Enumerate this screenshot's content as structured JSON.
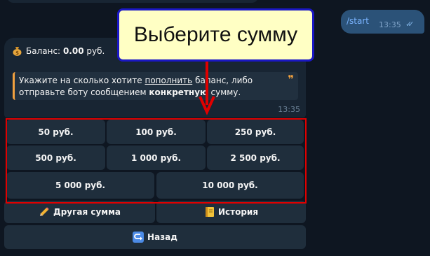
{
  "chat": {
    "outgoing": {
      "text": "/start",
      "time": "13:35"
    },
    "incoming": {
      "balance_prefix": "Баланс:",
      "balance_value": "0.00",
      "balance_currency": "руб.",
      "hint": {
        "part1": "Укажите на сколько хотите ",
        "link": "пополнить",
        "part2": " баланс, либо отправьте боту сообщением ",
        "bold": "конкретную",
        "part3": " сумму."
      },
      "time": "13:35"
    }
  },
  "keyboard": {
    "amounts": [
      "50 руб.",
      "100 руб.",
      "250 руб.",
      "500 руб.",
      "1 000 руб.",
      "2 500 руб.",
      "5 000 руб.",
      "10 000 руб."
    ],
    "other_label": "Другая сумма",
    "history_label": "История",
    "back_label": "Назад"
  },
  "annotation": {
    "callout_text": "Выберите сумму",
    "frame_color": "#e00000",
    "callout_border": "#1a17c4"
  }
}
